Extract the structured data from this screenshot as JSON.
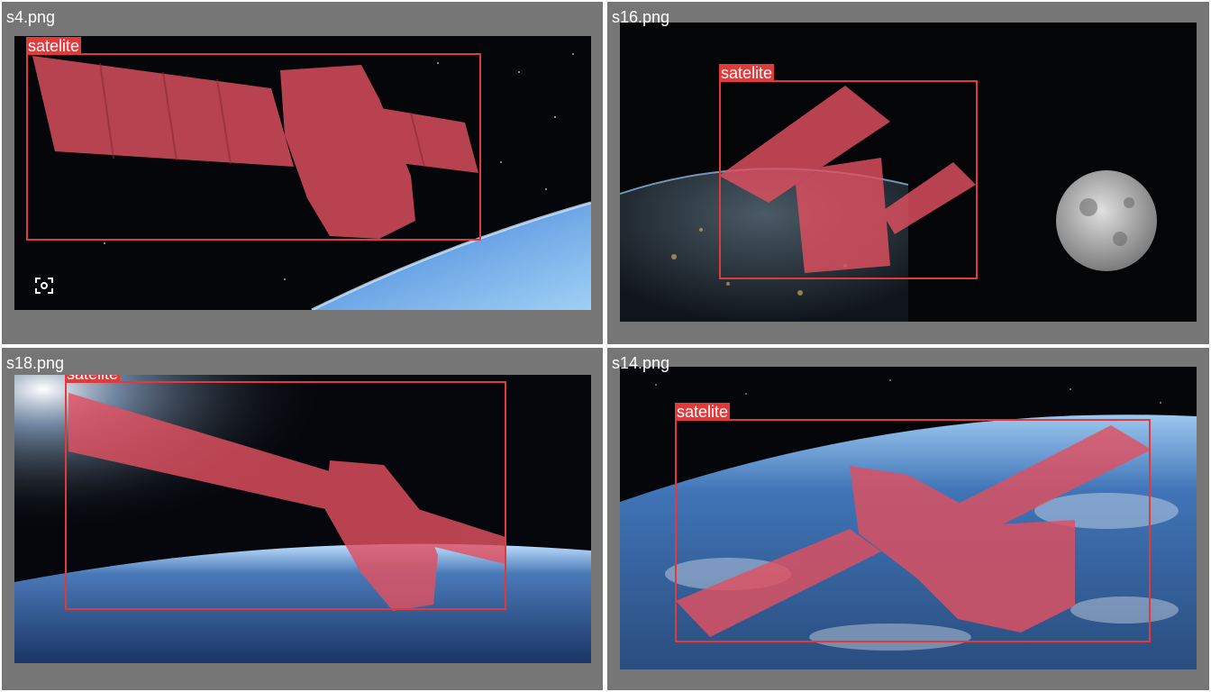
{
  "tiles": [
    {
      "filename": "s4.png",
      "detections": [
        {
          "label": "satelite"
        }
      ]
    },
    {
      "filename": "s16.png",
      "detections": [
        {
          "label": "satelite"
        }
      ]
    },
    {
      "filename": "s18.png",
      "detections": [
        {
          "label": "satelite"
        }
      ]
    },
    {
      "filename": "s14.png",
      "detections": [
        {
          "label": "satelite"
        }
      ]
    }
  ],
  "colors": {
    "grid_background": "#767676",
    "grid_divider": "#ffffff",
    "box": "#e03a3a",
    "mask": "#e05060",
    "label_text": "#ffffff"
  },
  "icons": [
    "google-lens-icon"
  ]
}
